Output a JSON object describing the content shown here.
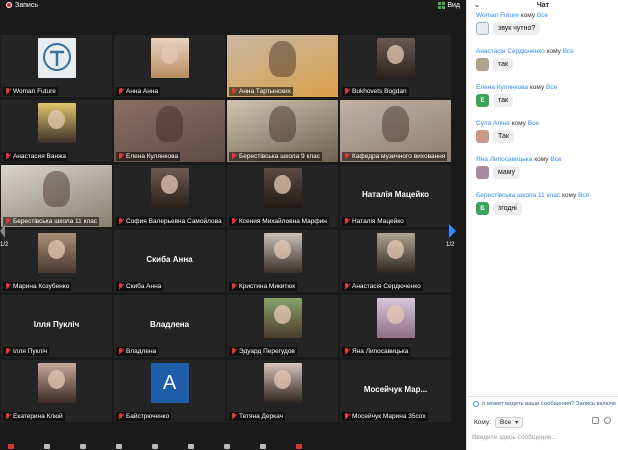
{
  "topbar": {
    "record_label": "Запись",
    "view_label": "Вид"
  },
  "tiles": [
    {
      "name": "Woman Future",
      "avatar": "logo-emblem",
      "colors": [
        "#e7ecef",
        "#3b6e9a"
      ]
    },
    {
      "name": "Анна Анна",
      "avatar": "portrait",
      "colors": [
        "#e8d2c2",
        "#b98f5f"
      ]
    },
    {
      "name": "Анна Тартынских",
      "avatar": "live-video",
      "colors": [
        "#c9b7a3",
        "#d9a14a"
      ],
      "active": true
    },
    {
      "name": "Bukhovets Bogdan",
      "avatar": "portrait",
      "colors": [
        "#6b5a52",
        "#2a221f"
      ]
    },
    {
      "name": "Анастасия Ванжа",
      "avatar": "portrait",
      "colors": [
        "#e0c76d",
        "#3b2f26"
      ]
    },
    {
      "name": "Елена Кулянкова",
      "avatar": "live-video",
      "colors": [
        "#8a6f64",
        "#5e4c45"
      ]
    },
    {
      "name": "Берестівська школа 9 клас",
      "avatar": "live-video",
      "colors": [
        "#cfc4b2",
        "#6e5f4e"
      ]
    },
    {
      "name": "Кафедра музичного виховання",
      "avatar": "live-video",
      "colors": [
        "#bfb3a6",
        "#8f7d6e"
      ]
    },
    {
      "name": "Берестівська школа 11 клас",
      "avatar": "live-video",
      "colors": [
        "#d8d5cf",
        "#8b7e6e"
      ]
    },
    {
      "name": "София Валерьевна Самойлова",
      "avatar": "portrait",
      "colors": [
        "#6e5a50",
        "#2a201c"
      ]
    },
    {
      "name": "Ксения Михайловна Марфин",
      "avatar": "portrait",
      "colors": [
        "#5c4a42",
        "#221a17"
      ]
    },
    {
      "name": "Наталія Мацейко",
      "avatar": "name-only",
      "display_name": "Наталія Мацейко"
    },
    {
      "name": "Марина Козубенко",
      "avatar": "portrait",
      "colors": [
        "#a88e76",
        "#4a3a30"
      ]
    },
    {
      "name": "Скиба Анна",
      "avatar": "name-only",
      "display_name": "Скиба Анна"
    },
    {
      "name": "Кристина Микитюк",
      "avatar": "portrait",
      "colors": [
        "#c9c3ba",
        "#3a2e28"
      ]
    },
    {
      "name": "Анастасія Сердюченко",
      "avatar": "portrait",
      "colors": [
        "#b0a48f",
        "#2b2621"
      ]
    },
    {
      "name": "Ілля Пукліч",
      "avatar": "name-only",
      "display_name": "Ілля Пукліч"
    },
    {
      "name": "Владлена",
      "avatar": "name-only",
      "display_name": "Владлена"
    },
    {
      "name": "Эдуард Перегудов",
      "avatar": "portrait",
      "colors": [
        "#8aa36a",
        "#4b3a2c"
      ]
    },
    {
      "name": "Яна Липосавицька",
      "avatar": "portrait",
      "colors": [
        "#d8c6d8",
        "#8e6f86"
      ]
    },
    {
      "name": "Екатерина Клюй",
      "avatar": "portrait",
      "colors": [
        "#c8a89a",
        "#3a2a25"
      ]
    },
    {
      "name": "Байстрюченко",
      "avatar": "letter",
      "letter": "A",
      "colors": [
        "#1e5ea8",
        "#1e5ea8"
      ]
    },
    {
      "name": "Тетяна Деркач",
      "avatar": "portrait",
      "colors": [
        "#d6c5bd",
        "#2e2220"
      ]
    },
    {
      "name": "Мосейчук Марина 35сох",
      "avatar": "name-only",
      "display_name": "Мосейчук Мар..."
    }
  ],
  "pager": {
    "left": "1/2",
    "right": "1/2"
  },
  "chat": {
    "title": "Чат",
    "to_word": "кому",
    "messages": [
      {
        "from": "Woman Future",
        "to": "Все",
        "text": "звук чутно?",
        "avatar": "logo-emblem",
        "avatar_color": "#e7ecef"
      },
      {
        "from": "Анастасія Сердюченко",
        "to": "Все",
        "text": "так",
        "avatar": "photo",
        "avatar_color": "#b0a48f"
      },
      {
        "from": "Елена Кулянкова",
        "to": "Все",
        "text": "так",
        "avatar": "letter",
        "letter": "Е",
        "avatar_color": "#3aa45a"
      },
      {
        "from": "Сула Аліна",
        "to": "Все",
        "text": "Так",
        "avatar": "photo",
        "avatar_color": "#c99a86"
      },
      {
        "from": "Яна Липосавицька",
        "to": "Все",
        "text": "маму",
        "avatar": "photo",
        "avatar_color": "#a58aa0"
      },
      {
        "from": "Берестівська школа 11 клас",
        "to": "Все",
        "text": "згодні",
        "avatar": "letter",
        "letter": "Б",
        "avatar_color": "#3aa45a"
      }
    ],
    "visibility_notice": "о может видеть ваши сообщения? Запись включе",
    "to_label": "Кому:",
    "to_value": "Все",
    "input_placeholder": "Введите здесь сообщение..."
  }
}
